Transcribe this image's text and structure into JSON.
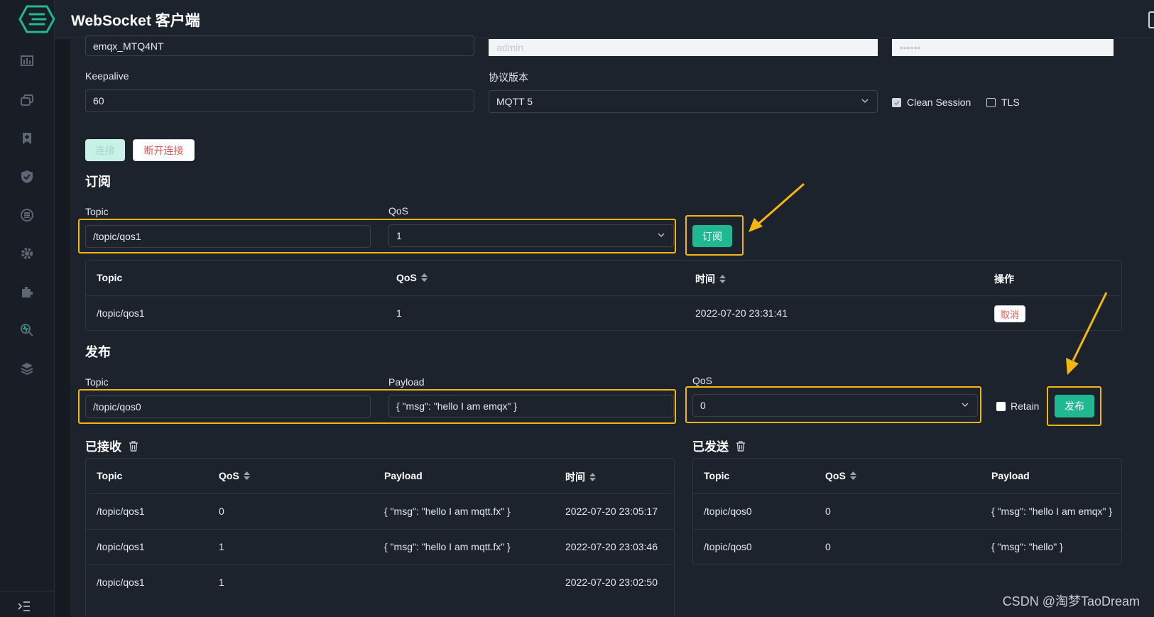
{
  "header": {
    "title": "WebSocket 客户端"
  },
  "connection": {
    "client_id_value": "emqx_MTQ4NT",
    "username_value": "admin",
    "password_value": "••••••",
    "keepalive_label": "Keepalive",
    "keepalive_value": "60",
    "protocol_label": "协议版本",
    "protocol_value": "MQTT 5",
    "clean_session_label": "Clean Session",
    "tls_label": "TLS",
    "connect_label": "连接",
    "disconnect_label": "断开连接"
  },
  "subscribe": {
    "title": "订阅",
    "topic_label": "Topic",
    "topic_value": "/topic/qos1",
    "qos_label": "QoS",
    "qos_value": "1",
    "button_label": "订阅",
    "table": {
      "headers": [
        "Topic",
        "QoS",
        "时间",
        "操作"
      ],
      "rows": [
        {
          "topic": "/topic/qos1",
          "qos": "1",
          "time": "2022-07-20 23:31:41",
          "action": "取消"
        }
      ]
    }
  },
  "publish": {
    "title": "发布",
    "topic_label": "Topic",
    "topic_value": "/topic/qos0",
    "payload_label": "Payload",
    "payload_value": "{ \"msg\": \"hello I am emqx\" }",
    "qos_label": "QoS",
    "qos_value": "0",
    "retain_label": "Retain",
    "button_label": "发布"
  },
  "received": {
    "title": "已接收",
    "headers": [
      "Topic",
      "QoS",
      "Payload",
      "时间"
    ],
    "rows": [
      {
        "topic": "/topic/qos1",
        "qos": "0",
        "payload": "{ \"msg\": \"hello I am mqtt.fx\" }",
        "time": "2022-07-20 23:05:17"
      },
      {
        "topic": "/topic/qos1",
        "qos": "1",
        "payload": "{ \"msg\": \"hello I am mqtt.fx\" }",
        "time": "2022-07-20 23:03:46"
      },
      {
        "topic": "/topic/qos1",
        "qos": "1",
        "payload": "",
        "time": "2022-07-20 23:02:50"
      }
    ]
  },
  "sent": {
    "title": "已发送",
    "headers": [
      "Topic",
      "QoS",
      "Payload"
    ],
    "rows": [
      {
        "topic": "/topic/qos0",
        "qos": "0",
        "payload": "{ \"msg\": \"hello I am emqx\" }"
      },
      {
        "topic": "/topic/qos0",
        "qos": "0",
        "payload": "{ \"msg\": \"hello\" }"
      }
    ]
  },
  "watermark": "CSDN @淘梦TaoDream",
  "colors": {
    "accent": "#1fb891",
    "highlight": "#f5b613",
    "danger": "#e05555",
    "background": "#1d232d"
  },
  "icons": [
    "dashboard-icon",
    "clients-icon",
    "subscriptions-icon",
    "security-icon",
    "rules-icon",
    "settings-icon",
    "plugins-icon",
    "diagnose-icon",
    "modules-icon",
    "collapse-sidebar-icon"
  ]
}
